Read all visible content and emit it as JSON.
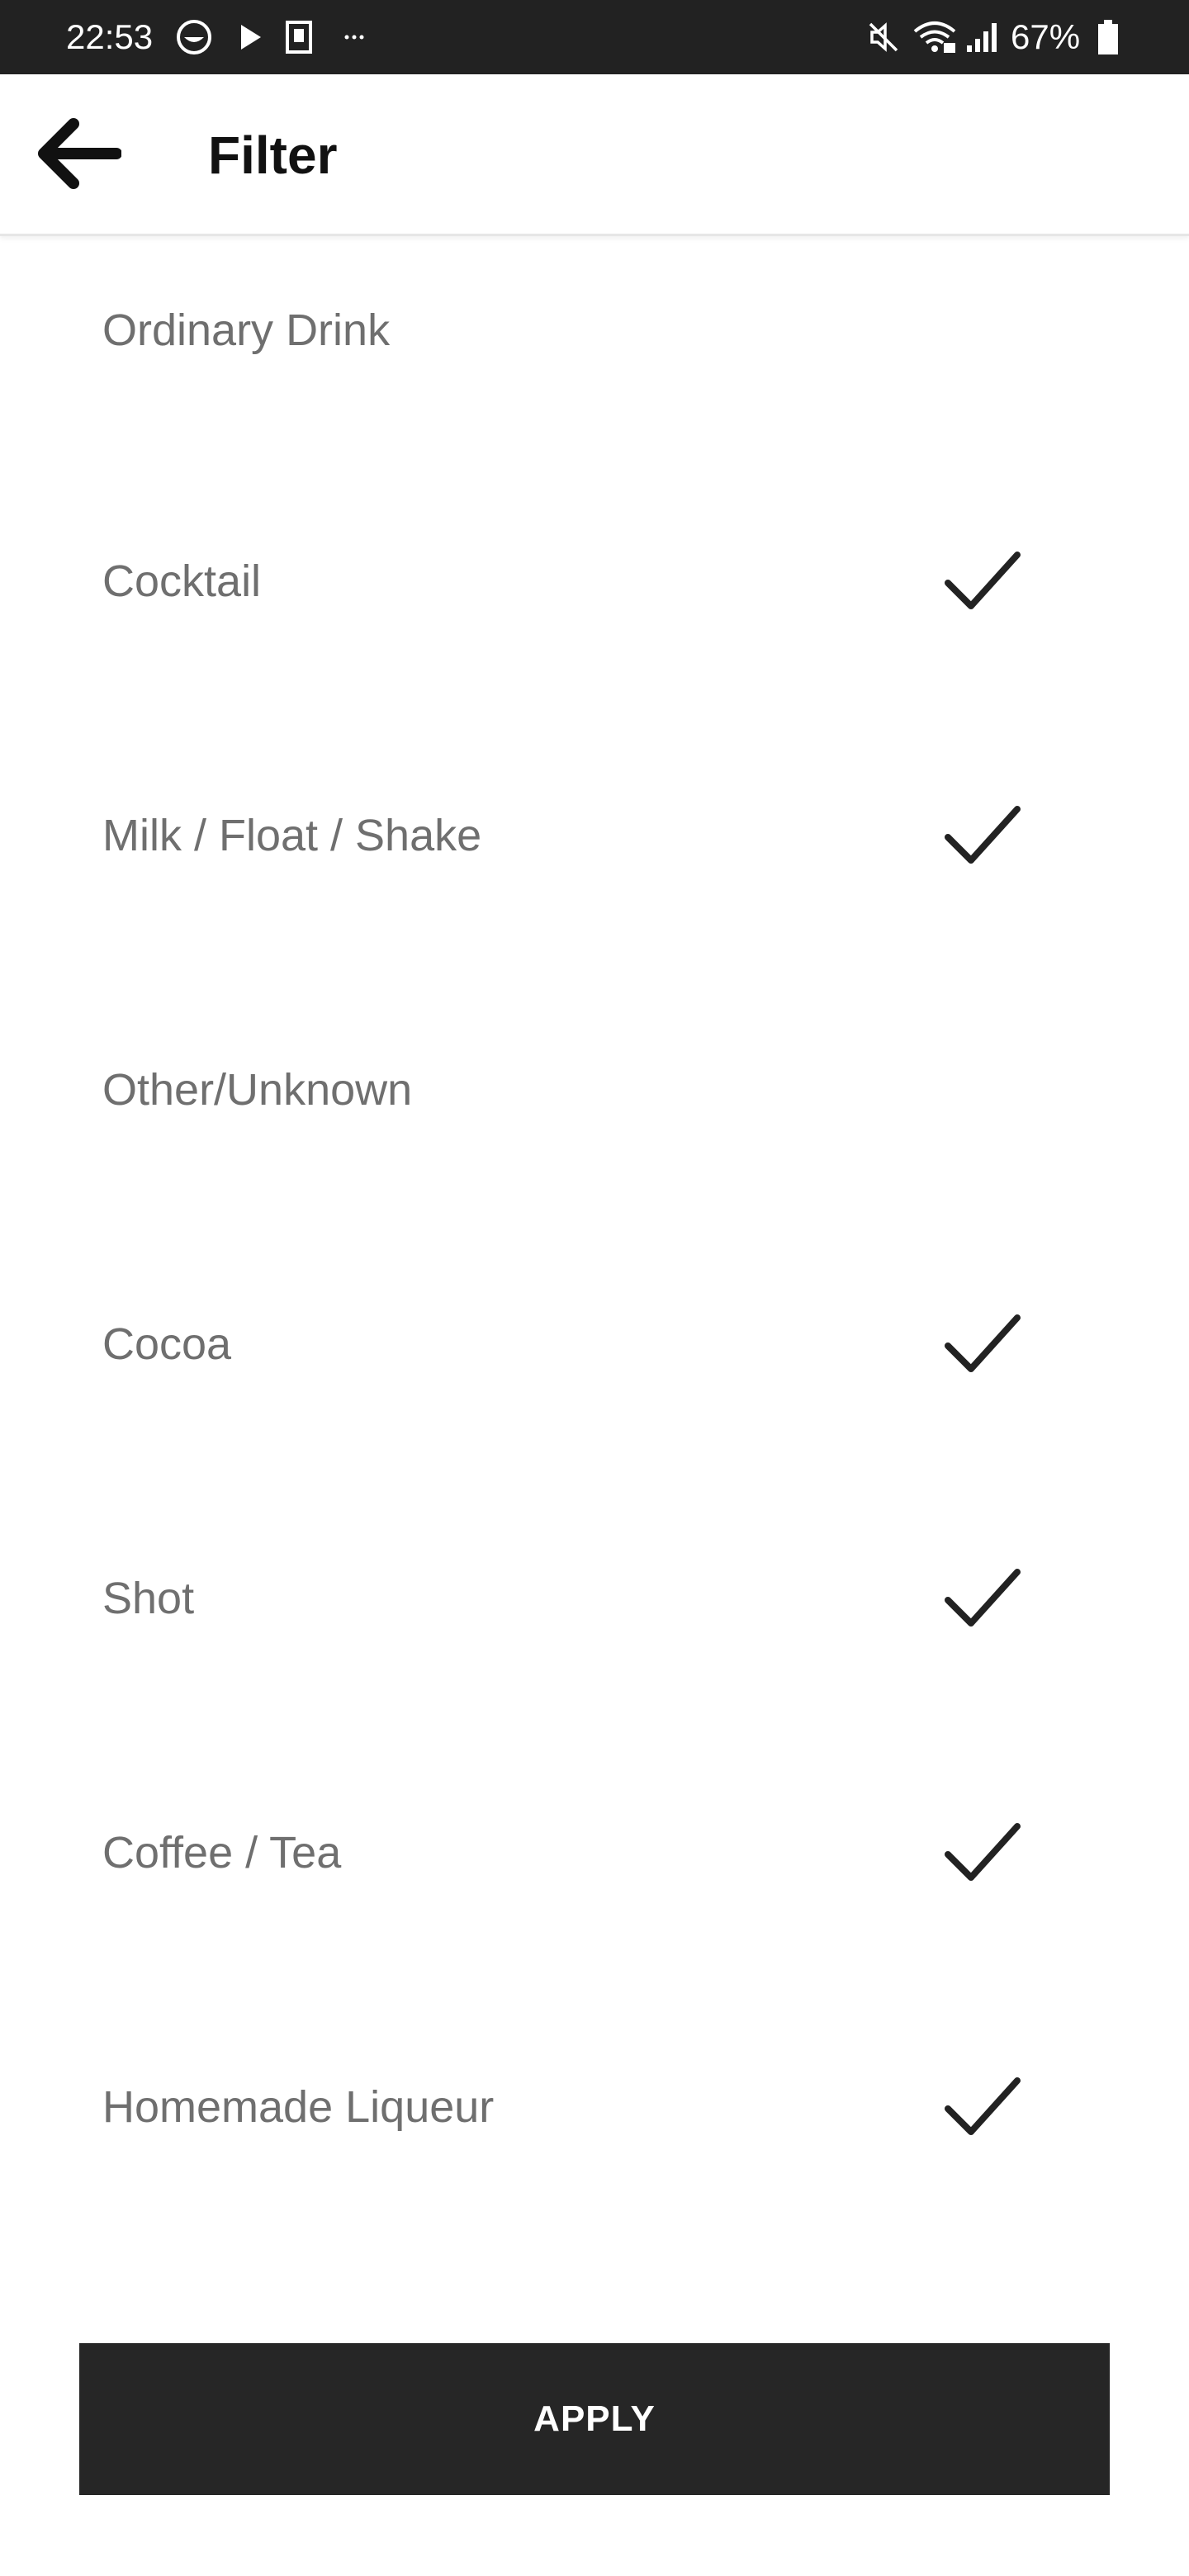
{
  "status_bar": {
    "time": "22:53",
    "battery": "67%",
    "icons": [
      "pocket-icon",
      "play-icon",
      "kindle-icon",
      "more-dots-icon",
      "mute-icon",
      "wifi-icon",
      "signal-icon",
      "battery-icon"
    ]
  },
  "header": {
    "back_icon": "arrow-left-icon",
    "title": "Filter"
  },
  "filters": [
    {
      "label": "Ordinary Drink",
      "checked": false
    },
    {
      "label": "Cocktail",
      "checked": true
    },
    {
      "label": "Milk / Float / Shake",
      "checked": true
    },
    {
      "label": "Other/Unknown",
      "checked": false
    },
    {
      "label": "Cocoa",
      "checked": true
    },
    {
      "label": "Shot",
      "checked": true
    },
    {
      "label": "Coffee / Tea",
      "checked": true
    },
    {
      "label": "Homemade Liqueur",
      "checked": true
    }
  ],
  "apply_label": "APPLY",
  "colors": {
    "status_bar_bg": "#222222",
    "apply_bg": "#262626",
    "label_text": "#6f6f6f",
    "check": "#222222"
  }
}
